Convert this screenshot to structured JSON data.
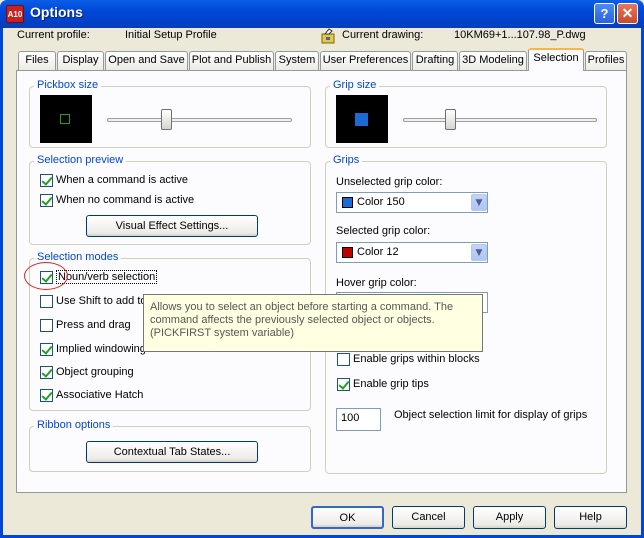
{
  "window": {
    "title": "Options",
    "app_icon_text": "A10",
    "help_glyph": "?",
    "close_glyph": "✕"
  },
  "profile": {
    "current_profile_label": "Current profile:",
    "current_profile_value": "Initial Setup Profile",
    "current_drawing_label": "Current drawing:",
    "current_drawing_value": "10KM69+1...107.98_P.dwg"
  },
  "tabs": [
    {
      "label": "Files"
    },
    {
      "label": "Display"
    },
    {
      "label": "Open and Save"
    },
    {
      "label": "Plot and Publish"
    },
    {
      "label": "System"
    },
    {
      "label": "User Preferences"
    },
    {
      "label": "Drafting"
    },
    {
      "label": "3D Modeling"
    },
    {
      "label": "Selection",
      "active": true
    },
    {
      "label": "Profiles"
    }
  ],
  "pickbox": {
    "title": "Pickbox size",
    "slider_level": 0.31
  },
  "grip_size": {
    "title": "Grip size",
    "slider_level": 0.23
  },
  "selection_preview": {
    "title": "Selection preview",
    "when_command_active": {
      "label": "When a command is active",
      "checked": true
    },
    "when_no_command_active": {
      "label": "When no command is active",
      "checked": true
    },
    "visual_effect_button": "Visual Effect Settings..."
  },
  "selection_modes": {
    "title": "Selection modes",
    "items": [
      {
        "label": "Noun/verb selection",
        "checked": true
      },
      {
        "label": "Use Shift to add to",
        "checked": false
      },
      {
        "label": "Press and drag",
        "checked": false
      },
      {
        "label": "Implied windowing",
        "checked": true
      },
      {
        "label": "Object grouping",
        "checked": true
      },
      {
        "label": "Associative Hatch",
        "checked": true
      }
    ]
  },
  "ribbon_options": {
    "title": "Ribbon options",
    "contextual_button": "Contextual Tab States..."
  },
  "grips": {
    "title": "Grips",
    "unselected_label": "Unselected grip color:",
    "unselected_value": "Color 150",
    "unselected_color": "#1c6ad4",
    "selected_label": "Selected grip color:",
    "selected_value": "Color 12",
    "selected_color": "#c00000",
    "hover_label": "Hover grip color:",
    "enable_grips_within_blocks": {
      "label": "Enable grips within blocks",
      "checked": false
    },
    "enable_grip_tips": {
      "label": "Enable grip tips",
      "checked": true
    },
    "object_limit_value": "100",
    "object_limit_label": "Object selection limit for display of grips"
  },
  "tooltip": {
    "text": "Allows you to select an object before starting a command. The command affects the previously selected object or objects. (PICKFIRST system variable)"
  },
  "buttons": {
    "ok": "OK",
    "cancel": "Cancel",
    "apply": "Apply",
    "help": "Help"
  },
  "colors": {
    "titlebar": "#0054e3",
    "accent_group_title": "#0046d5",
    "tab_highlight": "#f7b64c",
    "grip_square": "#1c6ad4",
    "pickbox_square": "#2a9a2a"
  }
}
